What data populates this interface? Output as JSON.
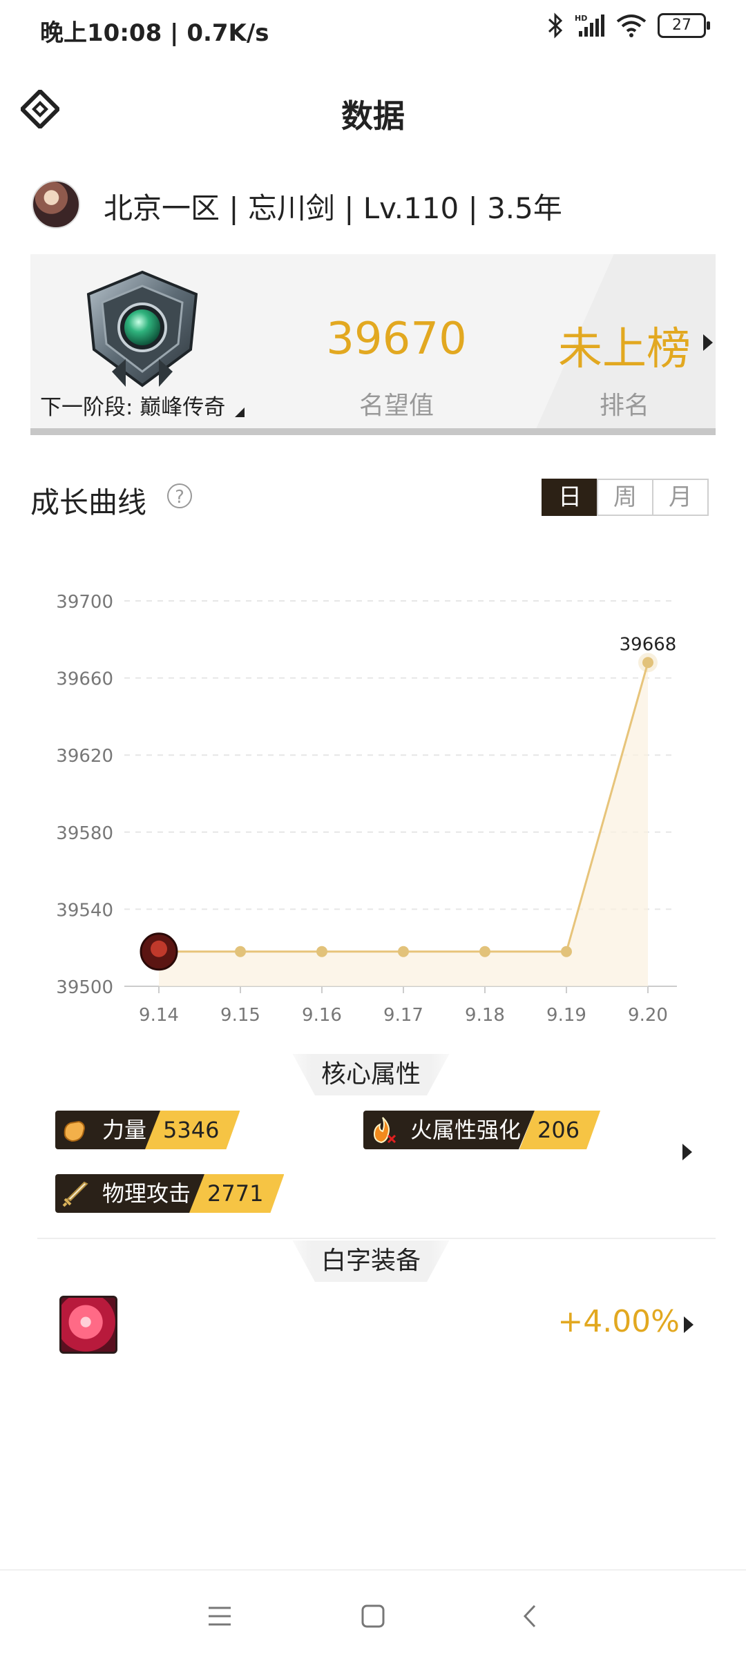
{
  "status_bar": {
    "time_speed": "晚上10:08 | 0.7K/s",
    "battery": "27",
    "icons": [
      "bluetooth-icon",
      "hd-signal-icon",
      "wifi-icon",
      "battery-icon"
    ]
  },
  "header": {
    "title": "数据",
    "logo_icon": "diamond-logo-icon"
  },
  "profile": {
    "text": "北京一区 | 忘川剑 | Lv.110 | 3.5年"
  },
  "rank_card": {
    "next_stage": "下一阶段: 巅峰传奇",
    "fame_value": "39670",
    "fame_label": "名望值",
    "rank_value": "未上榜",
    "rank_label": "排名"
  },
  "growth": {
    "title": "成长曲线",
    "help": "?",
    "tabs": [
      "日",
      "周",
      "月"
    ],
    "active_tab": "日"
  },
  "chart_data": {
    "type": "line",
    "x": [
      "9.14",
      "9.15",
      "9.16",
      "9.17",
      "9.18",
      "9.19",
      "9.20"
    ],
    "values": [
      39518,
      39518,
      39518,
      39518,
      39518,
      39518,
      39668
    ],
    "ylim": [
      39500,
      39700
    ],
    "yticks": [
      "39700",
      "39660",
      "39620",
      "39580",
      "39540",
      "39500"
    ],
    "last_label": "39668",
    "grid": true,
    "colors": {
      "line": "#e7c47a",
      "point": "#e2c27a",
      "fill": "#fbf1df",
      "axis": "#cccccc",
      "grid": "#e6e6e6",
      "tick": "#777777"
    }
  },
  "core_attributes": {
    "title": "核心属性",
    "items": [
      {
        "name": "力量",
        "value": "5346",
        "icon": "strength-fist-icon"
      },
      {
        "name": "火属性强化",
        "value": "206",
        "icon": "fire-element-icon"
      },
      {
        "name": "物理攻击",
        "value": "2771",
        "icon": "sword-icon"
      }
    ]
  },
  "white_equipment": {
    "title": "白字装备",
    "value": "+4.00%",
    "icon": "red-gem-icon"
  },
  "nav": {
    "items": [
      "menu-icon",
      "home-icon",
      "back-icon"
    ]
  }
}
